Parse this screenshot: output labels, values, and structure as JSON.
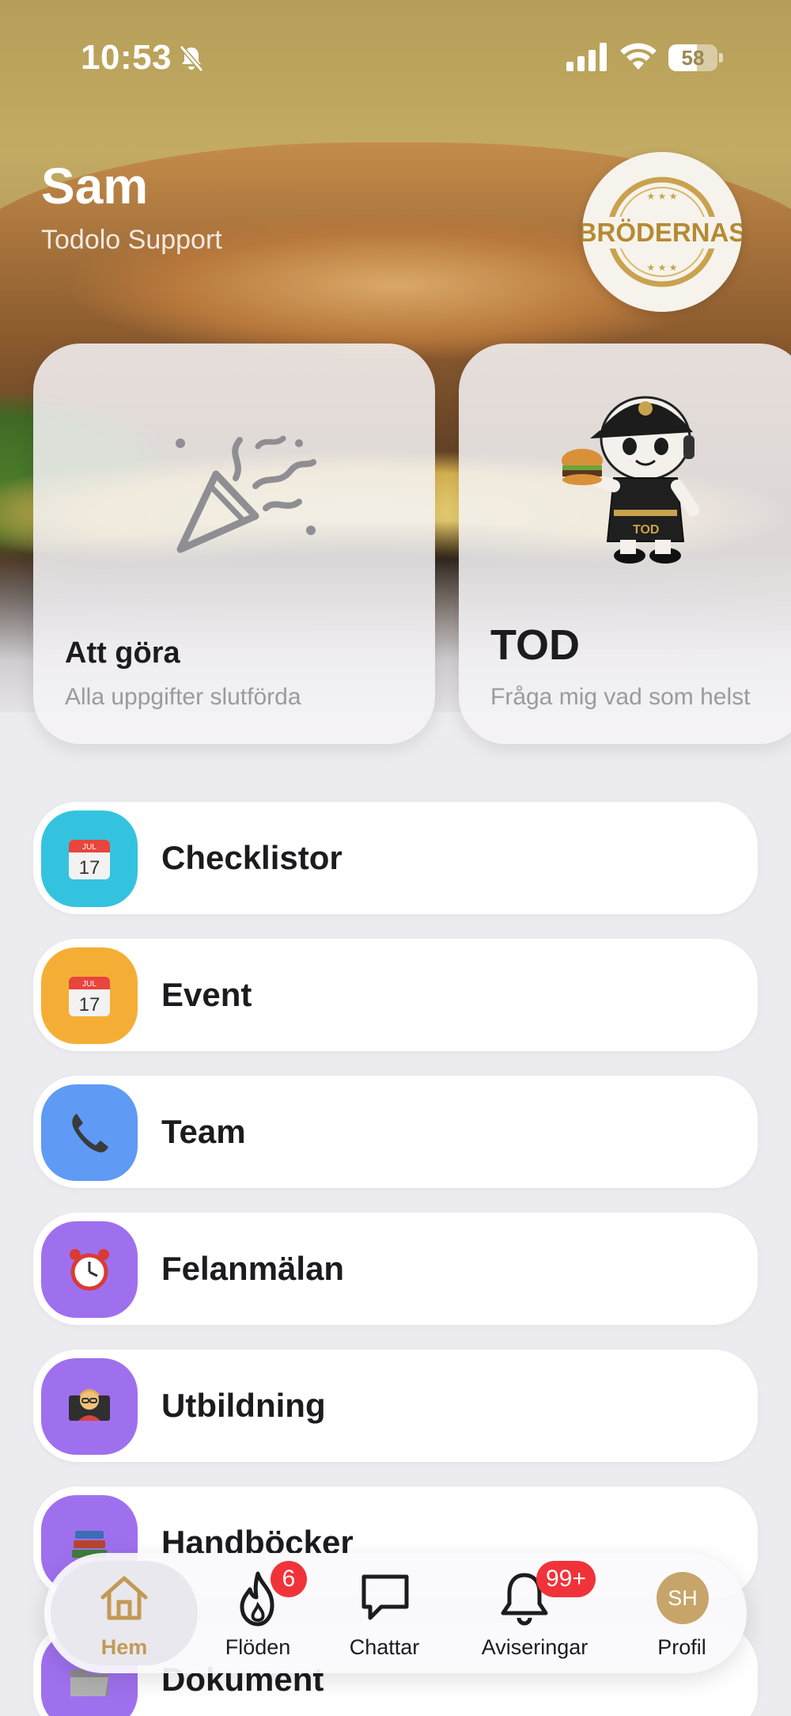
{
  "status": {
    "time": "10:53",
    "battery": "58",
    "battery_level": 0.58
  },
  "header": {
    "name": "Sam",
    "subtitle": "Todolo Support",
    "logo_text": "BRÖDERNAS"
  },
  "cards": [
    {
      "title": "Att göra",
      "subtitle": "Alla uppgifter slutförda",
      "icon": "party-popper-icon"
    },
    {
      "title": "TOD",
      "subtitle": "Fråga mig vad som helst",
      "icon": "mascot-icon",
      "mascot_label": "TOD"
    }
  ],
  "menu": [
    {
      "label": "Checklistor",
      "icon": "calendar-icon",
      "color": "#34c3df",
      "cal_month": "JUL",
      "cal_day": "17"
    },
    {
      "label": "Event",
      "icon": "calendar-icon",
      "color": "#f5ae35",
      "cal_month": "JUL",
      "cal_day": "17"
    },
    {
      "label": "Team",
      "icon": "phone-icon",
      "color": "#5f9af5"
    },
    {
      "label": "Felanmälan",
      "icon": "alarm-clock-icon",
      "color": "#9f70ee"
    },
    {
      "label": "Utbildning",
      "icon": "teacher-icon",
      "color": "#9f70ee"
    },
    {
      "label": "Handböcker",
      "icon": "books-icon",
      "color": "#9f70ee"
    },
    {
      "label": "Dokument",
      "icon": "folder-icon",
      "color": "#9f70ee"
    }
  ],
  "tabs": [
    {
      "label": "Hem",
      "icon": "home-icon",
      "active": true
    },
    {
      "label": "Flöden",
      "icon": "flame-icon",
      "badge": "6"
    },
    {
      "label": "Chattar",
      "icon": "chat-bubble-icon"
    },
    {
      "label": "Aviseringar",
      "icon": "bell-icon",
      "badge": "99+"
    },
    {
      "label": "Profil",
      "icon": "avatar",
      "initials": "SH"
    }
  ],
  "colors": {
    "accent_gold": "#c29a55",
    "badge_red": "#f0333a",
    "header_gold": "#b59e58"
  }
}
